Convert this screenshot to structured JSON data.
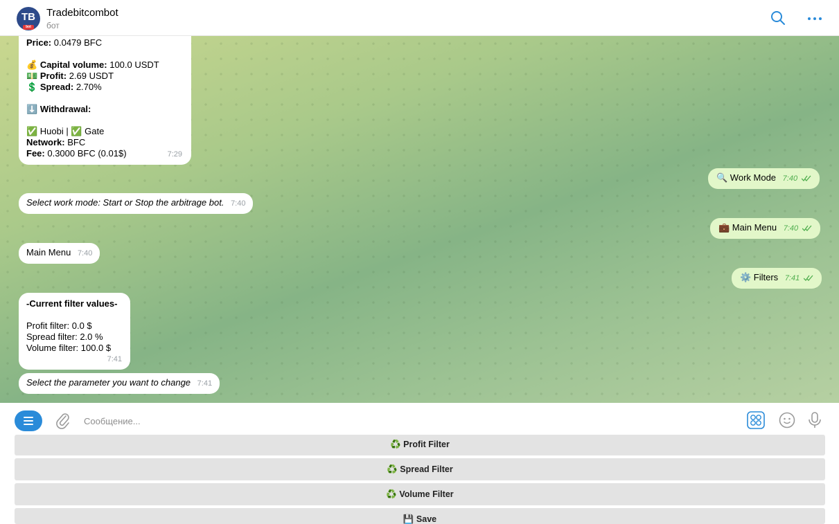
{
  "header": {
    "avatar_initials": "TB",
    "avatar_tag": "bot",
    "bot_name": "Tradebitcombot",
    "status": "бот",
    "icons": [
      "search-icon",
      "more-icon"
    ]
  },
  "messages": {
    "m1": {
      "price_label": "Price:",
      "price_value": " 0.0479 BFC",
      "capital_emoji": "💰",
      "capital_label": "Capital volume:",
      "capital_value": " 100.0 USDT",
      "profit_emoji": "💵",
      "profit_label": "Profit:",
      "profit_value": " 2.69 USDT",
      "spread_emoji": "💲",
      "spread_label": "Spread:",
      "spread_value": " 2.70%",
      "withdrawal_emoji": "⬇️",
      "withdrawal_label": "Withdrawal:",
      "exchanges_line": "✅ Huobi | ✅ Gate",
      "network_label": "Network:",
      "network_value": " BFC",
      "fee_label": "Fee:",
      "fee_value": " 0.3000 BFC (0.01$)",
      "time": "7:29"
    },
    "m2": {
      "text": "🔍 Work Mode",
      "time": "7:40"
    },
    "m3": {
      "text": "Select work mode: Start or Stop the arbitrage bot.",
      "time": "7:40"
    },
    "m4": {
      "text": "💼 Main Menu",
      "time": "7:40"
    },
    "m5": {
      "text": "Main Menu",
      "time": "7:40"
    },
    "m6": {
      "text": "⚙️ Filters",
      "time": "7:41"
    },
    "m7": {
      "title": "-Current filter values-",
      "profit": "Profit filter: 0.0 $",
      "spread": "Spread filter: 2.0 %",
      "volume": "Volume filter: 100.0 $",
      "time": "7:41"
    },
    "m8": {
      "text": "Select the parameter you want to change",
      "time": "7:41"
    }
  },
  "input": {
    "placeholder": "Сообщение...",
    "value": ""
  },
  "keyboard": {
    "buttons": [
      "♻️ Profit Filter",
      "♻️ Spread Filter",
      "♻️ Volume Filter",
      "💾 Save"
    ]
  },
  "colors": {
    "accent": "#2a8bd9",
    "outgoing_bubble": "#e2f7c9",
    "read_check": "#4fae4e",
    "keyboard_button": "#e3e3e3"
  }
}
